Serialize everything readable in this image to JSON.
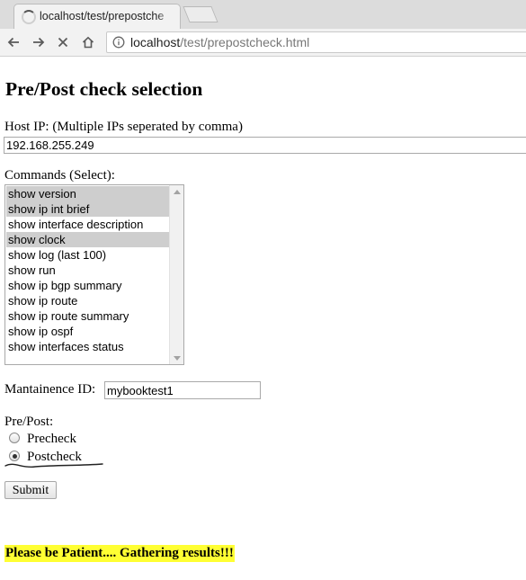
{
  "browser": {
    "tab_title": "localhost/test/prepostche",
    "url_host": "localhost",
    "url_path": "/test/prepostcheck.html"
  },
  "page": {
    "title": "Pre/Post check selection",
    "host_ip_label": "Host IP: (Multiple IPs seperated by comma)",
    "host_ip_value": "192.168.255.249",
    "commands_label": "Commands (Select):",
    "commands": [
      {
        "label": "show version",
        "selected": true
      },
      {
        "label": "show ip int brief",
        "selected": true
      },
      {
        "label": "show interface description",
        "selected": false
      },
      {
        "label": "show clock",
        "selected": true
      },
      {
        "label": "show log (last 100)",
        "selected": false
      },
      {
        "label": "show run",
        "selected": false
      },
      {
        "label": "show ip bgp summary",
        "selected": false
      },
      {
        "label": "show ip route",
        "selected": false
      },
      {
        "label": "show ip route summary",
        "selected": false
      },
      {
        "label": "show ip ospf",
        "selected": false
      },
      {
        "label": "show interfaces status",
        "selected": false
      }
    ],
    "maintenance_label": "Mantainence ID:",
    "maintenance_value": "mybooktest1",
    "prepost_label": "Pre/Post:",
    "precheck_label": "Precheck",
    "postcheck_label": "Postcheck",
    "selected_option": "Postcheck",
    "submit_label": "Submit",
    "status_message": "Please be Patient.... Gathering results!!!"
  },
  "colors": {
    "highlight": "#ffff33",
    "selected_item": "#cecece"
  }
}
